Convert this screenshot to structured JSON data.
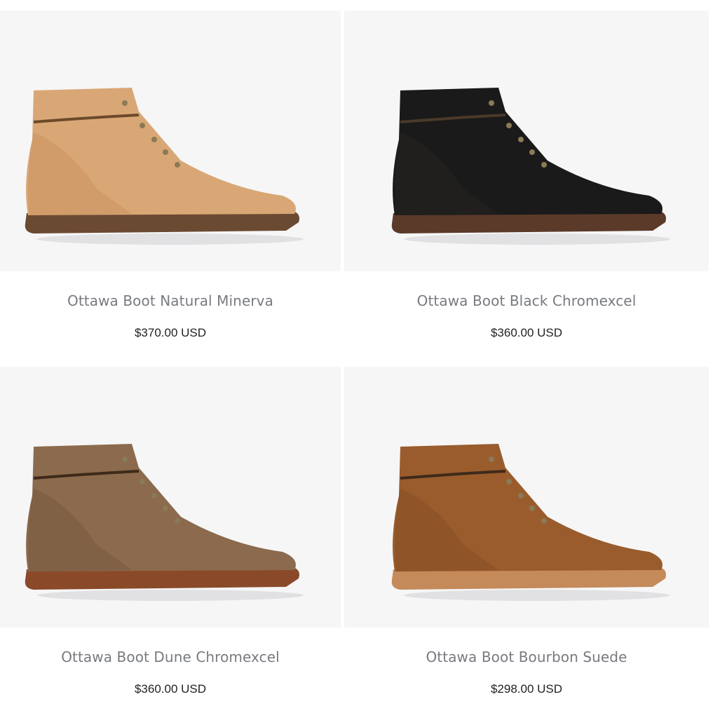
{
  "products": [
    {
      "name": "Ottawa Boot Natural Minerva",
      "price": "$370.00 USD",
      "leather_color": "#d9a775",
      "shade_color": "#c38a57",
      "sole_color": "#6b4a32",
      "lace_color": "#6b4a2a"
    },
    {
      "name": "Ottawa Boot Black Chromexcel",
      "price": "$360.00 USD",
      "leather_color": "#1a1a1a",
      "shade_color": "#2d2a28",
      "sole_color": "#5b3a2a",
      "lace_color": "#4a3a28"
    },
    {
      "name": "Ottawa Boot Dune Chromexcel",
      "price": "$360.00 USD",
      "leather_color": "#8b6a4d",
      "shade_color": "#6e5038",
      "sole_color": "#8a4a2a",
      "lace_color": "#3e2a1a"
    },
    {
      "name": "Ottawa Boot Bourbon Suede",
      "price": "$298.00 USD",
      "leather_color": "#9a5c2c",
      "shade_color": "#7b4521",
      "sole_color": "#c48a5a",
      "lace_color": "#3e2a1a"
    }
  ]
}
